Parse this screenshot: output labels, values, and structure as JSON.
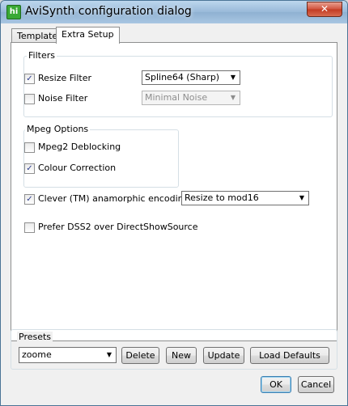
{
  "window": {
    "title": "AviSynth configuration dialog",
    "close_label": "✕",
    "icon_text": "hi"
  },
  "tabs": [
    {
      "label": "Template",
      "active": false
    },
    {
      "label": "Extra Setup",
      "active": true
    }
  ],
  "filters": {
    "group_label": "Filters",
    "resize": {
      "label": "Resize Filter",
      "checked": true,
      "value": "Spline64 (Sharp)"
    },
    "noise": {
      "label": "Noise Filter",
      "checked": false,
      "value": "Minimal Noise"
    }
  },
  "mpeg": {
    "group_label": "Mpeg Options",
    "deblocking": {
      "label": "Mpeg2 Deblocking",
      "checked": false
    },
    "colour": {
      "label": "Colour Correction",
      "checked": true
    }
  },
  "anamorphic": {
    "label": "Clever (TM) anamorphic encoding:",
    "checked": true,
    "value": "Resize to mod16"
  },
  "dss2": {
    "label": "Prefer DSS2 over DirectShowSource",
    "checked": false
  },
  "presets": {
    "group_label": "Presets",
    "selected": "zoome",
    "delete_label": "Delete",
    "new_label": "New",
    "update_label": "Update",
    "load_defaults_label": "Load Defaults"
  },
  "footer": {
    "ok_label": "OK",
    "cancel_label": "Cancel"
  },
  "glyphs": {
    "check": "✓",
    "arrow": "▼"
  }
}
